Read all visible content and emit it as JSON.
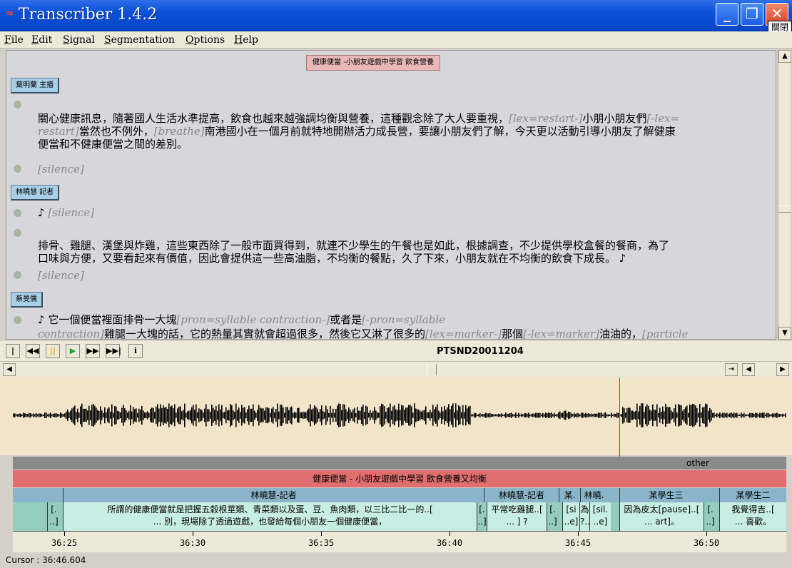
{
  "window": {
    "title": "Transcriber 1.4.2",
    "close_label": "關閉"
  },
  "menu": [
    "File",
    "Edit",
    "Signal",
    "Segmentation",
    "Options",
    "Help"
  ],
  "transcript": {
    "section_title": "健康便當 -小朋友遊戲中學習 飲食營養",
    "speakers": [
      "葉明蘭 主播",
      "林曉慧 記者",
      "蔡旻儒"
    ],
    "lines": [
      [
        "關心健康訊息，隨著國人生活水準提高，飲食也越來越強調均衡與營養，這種觀念除了大人要重視，",
        "[lex=restart-]",
        "小朋小朋友們",
        "[-lex="
      ],
      [
        "restart]",
        "當然也不例外，",
        "[breathe]",
        "南港國小在一個月前就特地開辦活力成長營，要讓小朋友們了解，今天更以活動引導小朋友了解健康"
      ],
      [
        "便當和不健康便當之間的差別。"
      ],
      [
        "[silence]"
      ],
      [
        "♪ ",
        "[silence]"
      ],
      [
        "排骨、雞腿、漢堡與炸雞，這些東西除了一般市面買得到，就連不少學生的午餐也是如此，根據調查，不少提供學校盒餐的餐商，為了"
      ],
      [
        "口味與方便，又要看起來有價值，因此會提供這一些高油脂，不均衡的餐點，久了下來，小朋友就在不均衡的飲食下成長。 ♪"
      ],
      [
        "[silence]"
      ],
      [
        "♪ 它一個便當裡面排骨一大塊",
        "[pron=syllable contraction-]",
        "或者是",
        "[-pron=syllable"
      ],
      [
        "contraction]",
        "雞腿一大塊的話，它的熱量其實就會超過很多，然後它又淋了很多的",
        "[lex=marker-]",
        "那個",
        "[-lex=marker]",
        "油油的，",
        "[particle"
      ]
    ]
  },
  "toolbar": {
    "signal_name": "PTSND20011204",
    "info_icon": "i"
  },
  "tracks": {
    "other": "other",
    "topic": "健康便當 - 小朋友遊戲中學習 飲食營養又均衡",
    "turns": [
      "林曉慧-記者",
      "林曉慧-記者",
      "某.",
      "林曉.",
      "某學生三",
      "某學生二"
    ],
    "segments": [
      [
        "[.",
        "..]"
      ],
      [
        "所謂的健康便當就是把握五穀根莖類、青菜類以及蛋、豆、魚肉類，以三比二比一的..[",
        "... 別，現場除了透過遊戲，也發給每個小朋友一個健康便當，"
      ],
      [
        "[.",
        "..]"
      ],
      [
        "平常吃雞腿..[",
        "... ] ?"
      ],
      [
        "[.",
        "..]"
      ],
      [
        "[si",
        "..e]"
      ],
      [
        "為",
        "?.."
      ],
      [
        "[sil.",
        "..e]"
      ],
      [
        "因為皮太[pause]..[",
        "... art]。"
      ],
      [
        "[.",
        "..]"
      ],
      [
        "我覺得吉..[",
        "... 喜歡。"
      ]
    ]
  },
  "ruler": [
    "36:25",
    "36:30",
    "36:35",
    "36:40",
    "36:45",
    "36:50"
  ],
  "status": "Cursor : 36:46.604"
}
